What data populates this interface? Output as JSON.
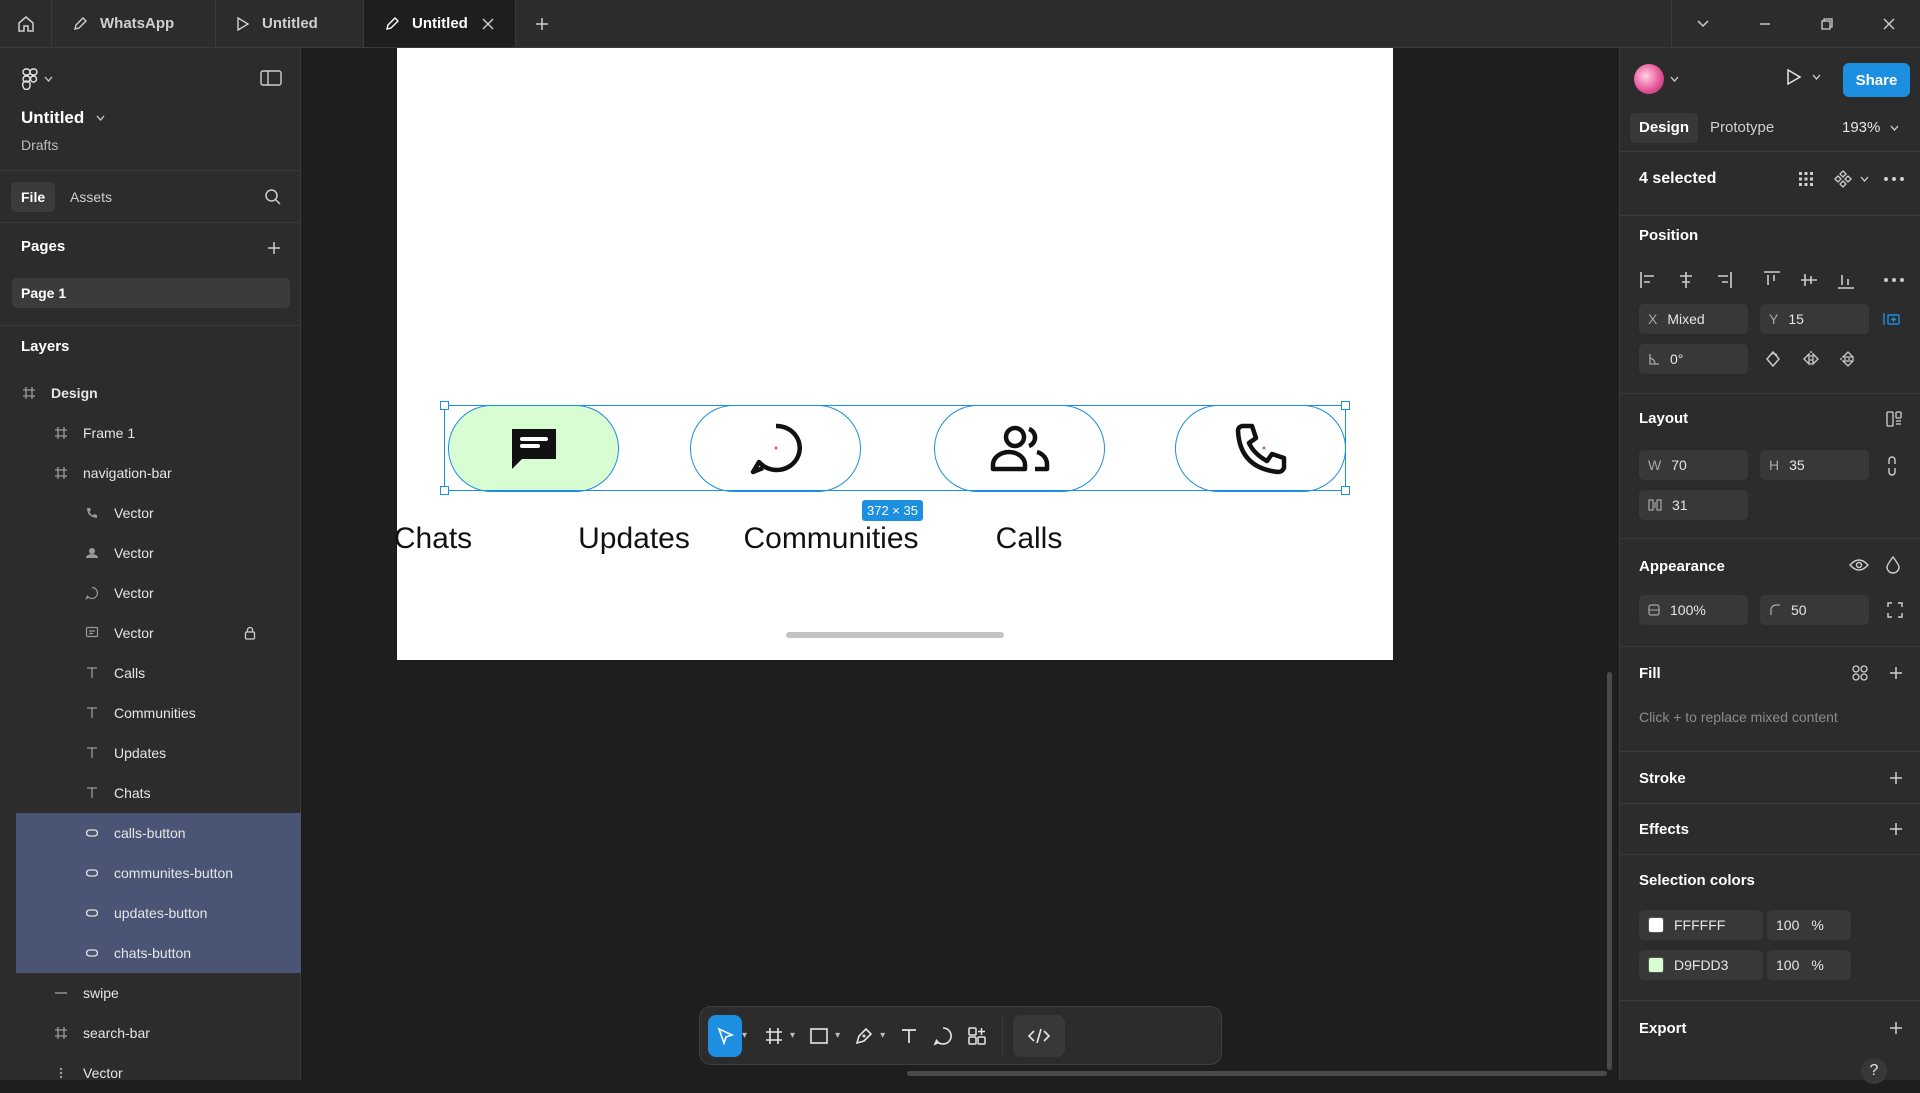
{
  "tabs": [
    {
      "label": "WhatsApp"
    },
    {
      "label": "Untitled"
    },
    {
      "label": "Untitled"
    }
  ],
  "file": {
    "title": "Untitled",
    "location": "Drafts"
  },
  "left_tabs": {
    "file": "File",
    "assets": "Assets"
  },
  "pages": {
    "title": "Pages",
    "items": [
      "Page 1"
    ]
  },
  "layers": {
    "title": "Layers",
    "items": [
      {
        "label": "Design",
        "icon": "frame-icon"
      },
      {
        "label": "Frame 1",
        "icon": "frame-icon"
      },
      {
        "label": "navigation-bar",
        "icon": "frame-icon"
      },
      {
        "label": "Vector",
        "icon": "phone-vector-icon"
      },
      {
        "label": "Vector",
        "icon": "people-vector-icon"
      },
      {
        "label": "Vector",
        "icon": "chat-vector-icon"
      },
      {
        "label": "Vector",
        "icon": "message-vector-icon"
      },
      {
        "label": "Calls",
        "icon": "text-icon"
      },
      {
        "label": "Communities",
        "icon": "text-icon"
      },
      {
        "label": "Updates",
        "icon": "text-icon"
      },
      {
        "label": "Chats",
        "icon": "text-icon"
      },
      {
        "label": "calls-button",
        "icon": "rectangle-icon"
      },
      {
        "label": "communites-button",
        "icon": "rectangle-icon"
      },
      {
        "label": "updates-button",
        "icon": "rectangle-icon"
      },
      {
        "label": "chats-button",
        "icon": "rectangle-icon"
      },
      {
        "label": "swipe",
        "icon": "line-icon"
      },
      {
        "label": "search-bar",
        "icon": "frame-icon"
      },
      {
        "label": "Vector",
        "icon": "vector-icon"
      }
    ]
  },
  "canvas": {
    "nav_labels": [
      "Chats",
      "Updates",
      "Communities",
      "Calls"
    ],
    "selection_size": "372 × 35"
  },
  "right": {
    "share": "Share",
    "design_tab": "Design",
    "prototype_tab": "Prototype",
    "zoom": "193%",
    "selected": "4 selected",
    "position": {
      "title": "Position",
      "x_label": "X",
      "x": "Mixed",
      "y_label": "Y",
      "y": "15",
      "rotation": "0°"
    },
    "layout": {
      "title": "Layout",
      "w_label": "W",
      "w": "70",
      "h_label": "H",
      "h": "35",
      "gap": "31"
    },
    "appearance": {
      "title": "Appearance",
      "opacity": "100%",
      "radius": "50"
    },
    "fill": {
      "title": "Fill",
      "hint": "Click + to replace mixed content"
    },
    "stroke": {
      "title": "Stroke"
    },
    "effects": {
      "title": "Effects"
    },
    "selection_colors": {
      "title": "Selection colors",
      "items": [
        {
          "hex": "FFFFFF",
          "opacity": "100",
          "unit": "%",
          "color": "#FFFFFF"
        },
        {
          "hex": "D9FDD3",
          "opacity": "100",
          "unit": "%",
          "color": "#D9FDD3"
        }
      ]
    },
    "export": {
      "title": "Export"
    },
    "help": "?"
  },
  "colors": {
    "accent": "#1D8FE0",
    "active_pill": "#D9FDD3",
    "selection_row": "#4A5575"
  }
}
